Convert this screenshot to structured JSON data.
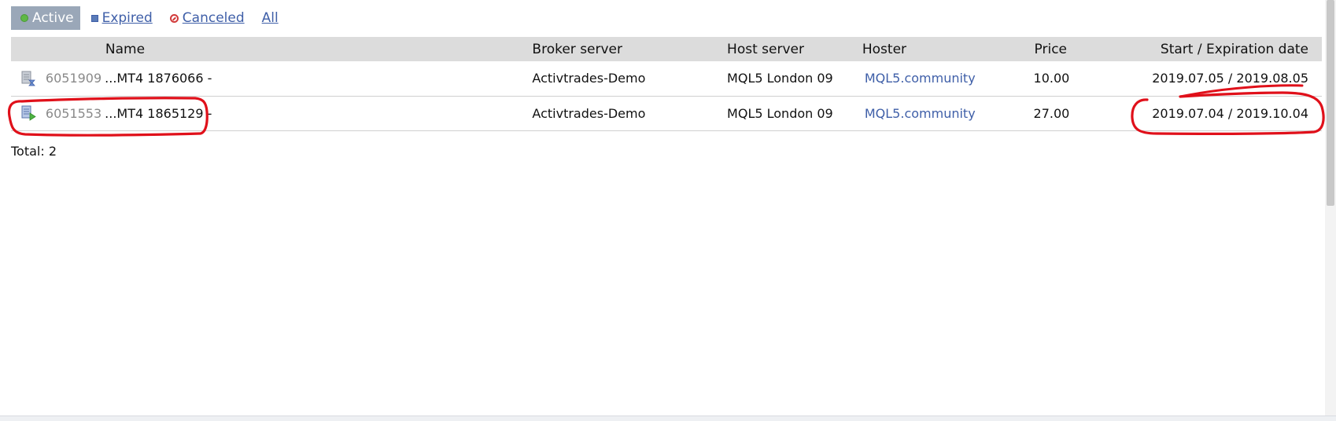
{
  "filters": [
    {
      "label": "Active",
      "icon": "green-dot-icon",
      "selected": true
    },
    {
      "label": "Expired",
      "icon": "blue-square-icon",
      "selected": false
    },
    {
      "label": "Canceled",
      "icon": "cancel-icon",
      "selected": false
    },
    {
      "label": "All",
      "icon": "",
      "selected": false
    }
  ],
  "table": {
    "headers": {
      "name": "Name",
      "broker": "Broker server",
      "host": "Host server",
      "hoster": "Hoster",
      "price": "Price",
      "dates": "Start / Expiration date"
    },
    "rows": [
      {
        "icon": "server-expiring-icon",
        "id": "6051909",
        "name": "...MT4 1876066 -",
        "broker": "Activtrades-Demo",
        "host": "MQL5 London 09",
        "hoster": "MQL5.community",
        "price": "10.00",
        "dates": "2019.07.05 / 2019.08.05"
      },
      {
        "icon": "server-running-icon",
        "id": "6051553",
        "name": "...MT4 1865129 -",
        "broker": "Activtrades-Demo",
        "host": "MQL5 London 09",
        "hoster": "MQL5.community",
        "price": "27.00",
        "dates": "2019.07.04 / 2019.10.04"
      }
    ]
  },
  "total": "Total: 2",
  "colors": {
    "active_bg": "#9aa7b8",
    "link": "#3f5fa8",
    "header_bg": "#dcdcdc",
    "annotation": "#e0101a"
  }
}
